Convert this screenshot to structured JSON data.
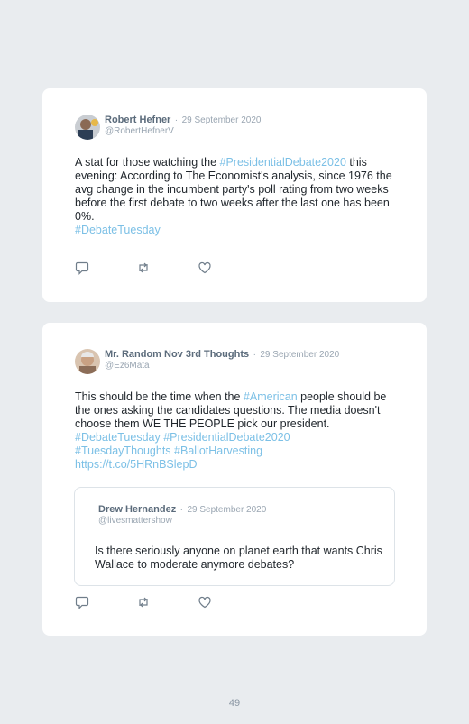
{
  "tweets": [
    {
      "author": "Robert Hefner",
      "separator": "·",
      "date": "29 September 2020",
      "handle": "@RobertHefnerV",
      "text": {
        "t1": "A stat for those watching the ",
        "tag1": "#PresidentialDebate2020",
        "t2": " this evening: According to The Economist's analysis, since 1976 the avg change in the incumbent party's poll rating from two weeks before the first debate to two weeks after the last one has been 0%.",
        "tag2": "#DebateTuesday"
      }
    },
    {
      "author": "Mr. Random Nov 3rd Thoughts",
      "separator": "·",
      "date": "29 September 2020",
      "handle": "@Ez6Mata",
      "text": {
        "t1": "This should be the time when the ",
        "tag1": "#American",
        "t2": " people should be the ones asking the candidates questions. The media doesn't choose them WE THE PEOPLE pick our president.",
        "tag2": "#DebateTuesday",
        "tag3": "#PresidentialDebate2020",
        "tag4": "#TuesdayThoughts",
        "tag5": "#BallotHarvesting",
        "link": "https://t.co/5HRnBSlepD"
      },
      "quoted": {
        "author": "Drew Hernandez",
        "separator": "·",
        "date": "29 September 2020",
        "handle": "@livesmattershow",
        "text": "Is there seriously anyone on planet earth that wants Chris Wallace to moderate anymore debates?"
      }
    }
  ],
  "icons": [
    "reply-icon",
    "retweet-icon",
    "like-icon"
  ],
  "colors": {
    "hashtag": "#7cc0e6",
    "name": "#5b6b7b",
    "muted": "#9aa6b2",
    "background": "#e9ecef"
  },
  "page_number": "49"
}
